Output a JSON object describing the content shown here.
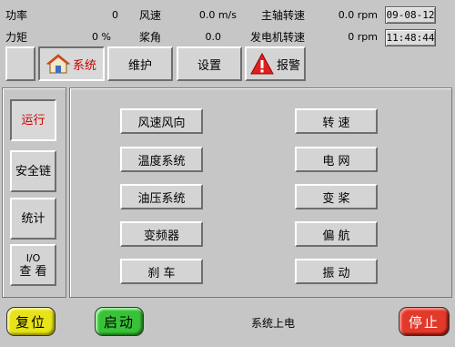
{
  "status": {
    "power_label": "功率",
    "power_value": "0",
    "torque_label": "力矩",
    "torque_value": "0 %",
    "wind_label": "风速",
    "wind_value": "0.0 m/s",
    "pitch_label": "桨角",
    "pitch_value": "0.0",
    "main_shaft_label": "主轴转速",
    "main_shaft_value": "0.0 rpm",
    "gen_speed_label": "发电机转速",
    "gen_speed_value": "0 rpm",
    "date": "09-08-12",
    "time": "11:48:44"
  },
  "tabs": {
    "system": "系统",
    "maintenance": "维护",
    "settings": "设置",
    "alarm": "报警"
  },
  "sidebar": {
    "run": "运行",
    "safety_chain": "安全链",
    "statistics": "统计",
    "io_line1": "I/O",
    "io_line2": "查 看"
  },
  "menu_left": [
    "风速风向",
    "温度系统",
    "油压系统",
    "变频器",
    "刹 车"
  ],
  "menu_right": [
    "转 速",
    "电 网",
    "变 桨",
    "偏 航",
    "振 动"
  ],
  "bottom": {
    "reset": "复位",
    "start": "启动",
    "status_text": "系统上电",
    "stop": "停止"
  },
  "colors": {
    "run_text": "#cc0000",
    "reset_btn": "#e7e21a",
    "start_btn": "#39c239",
    "stop_btn": "#e23a2a"
  },
  "icons": {
    "system": "house-icon",
    "alarm": "warning-triangle-icon"
  }
}
